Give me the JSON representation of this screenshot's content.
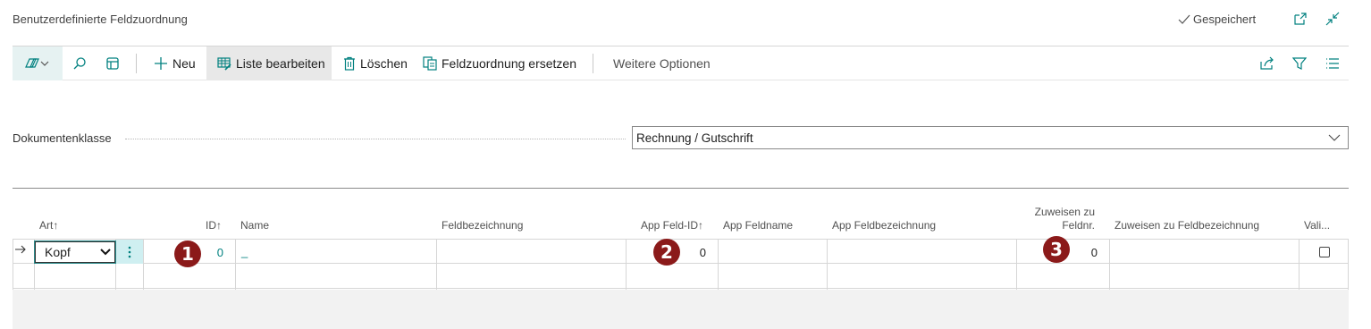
{
  "header": {
    "title": "Benutzerdefinierte Feldzuordnung",
    "saved_label": "Gespeichert"
  },
  "toolbar": {
    "new_label": "Neu",
    "edit_list_label": "Liste bearbeiten",
    "delete_label": "Löschen",
    "replace_label": "Feldzuordnung ersetzen",
    "more_label": "Weitere Optionen"
  },
  "form": {
    "doc_class_label": "Dokumentenklasse",
    "doc_class_value": "Rechnung / Gutschrift"
  },
  "grid": {
    "columns": {
      "art": "Art",
      "id": "ID",
      "name": "Name",
      "feldbezeichnung": "Feldbezeichnung",
      "app_feld_id": "App Feld-ID",
      "app_feldname": "App Feldname",
      "app_feldbezeichnung": "App Feldbezeichnung",
      "zuweisen_feldnr_line1": "Zuweisen zu",
      "zuweisen_feldnr_line2": "Feldnr.",
      "zuweisen_feldbez": "Zuweisen zu Feldbezeichnung",
      "vali": "Vali..."
    },
    "sort_arrow": "↑",
    "rows": [
      {
        "art": "Kopf",
        "id": "0",
        "name": "_",
        "app_feld_id": "0",
        "zuweisen_feldnr": "0"
      }
    ]
  },
  "badges": [
    "1",
    "2",
    "3"
  ],
  "colors": {
    "accent": "#00807f",
    "badge": "#8b1a1a",
    "more_cell": "#cfeff1"
  }
}
